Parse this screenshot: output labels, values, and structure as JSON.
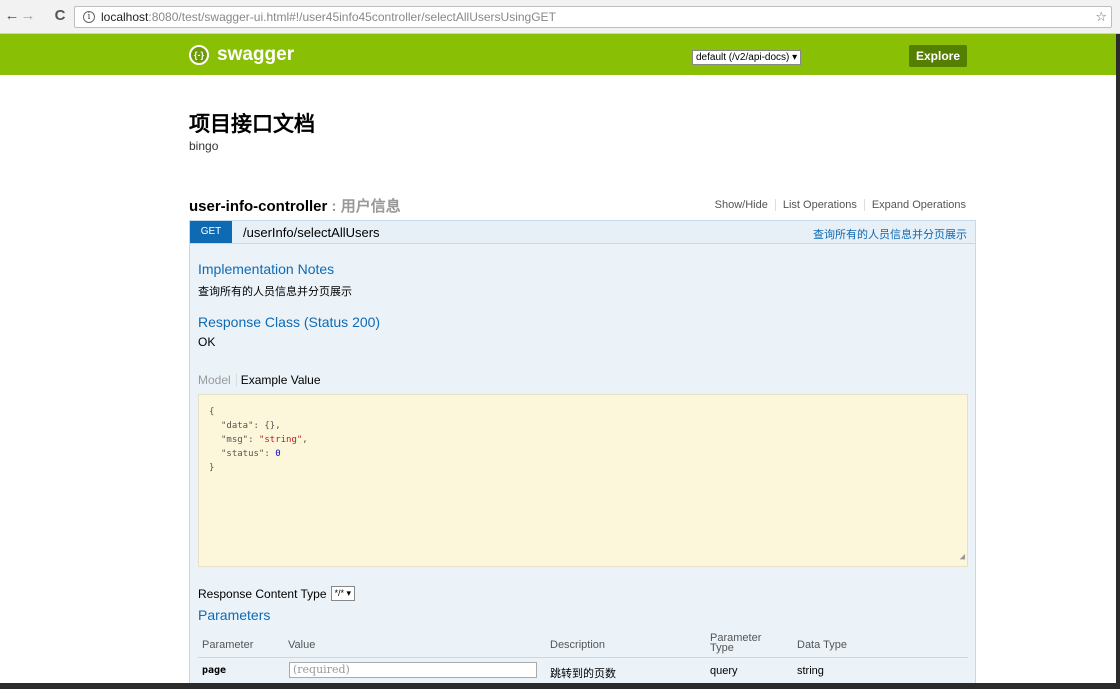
{
  "browser": {
    "url_host": "localhost",
    "url_rest": ":8080/test/swagger-ui.html#!/user45info45controller/selectAllUsersUsingGET"
  },
  "header": {
    "logo_text": "swagger",
    "logo_icon_text": "{-}",
    "api_select": "default (/v2/api-docs) ▾",
    "explore_label": "Explore",
    "color": "#89bf04"
  },
  "doc": {
    "title": "项目接口文档",
    "description": "bingo"
  },
  "controller": {
    "name": "user-info-controller",
    "separator": " : ",
    "description": "用户信息",
    "ops": [
      "Show/Hide",
      "List Operations",
      "Expand Operations"
    ]
  },
  "operation": {
    "method": "GET",
    "path": "/userInfo/selectAllUsers",
    "summary": "查询所有的人员信息并分页展示",
    "impl_notes_title": "Implementation Notes",
    "impl_notes_text": "查询所有的人员信息并分页展示",
    "response_class_title": "Response Class (Status 200)",
    "response_class_text": "OK",
    "tab_model": "Model",
    "tab_example": "Example Value",
    "example": {
      "open": "{",
      "data_key": "\"data\"",
      "data_val": "{},",
      "msg_key": "\"msg\"",
      "msg_val": "\"string\"",
      "status_key": "\"status\"",
      "status_val": "0",
      "close": "}"
    },
    "response_content_type_label": "Response Content Type",
    "response_content_type_value": "*/* ▾",
    "parameters_title": "Parameters",
    "param_headers": {
      "parameter": "Parameter",
      "value": "Value",
      "description": "Description",
      "param_type": "Parameter Type",
      "data_type": "Data Type"
    },
    "params": [
      {
        "name": "page",
        "placeholder": "(required)",
        "description": "跳转到的页数",
        "param_type": "query",
        "data_type": "string"
      }
    ]
  }
}
